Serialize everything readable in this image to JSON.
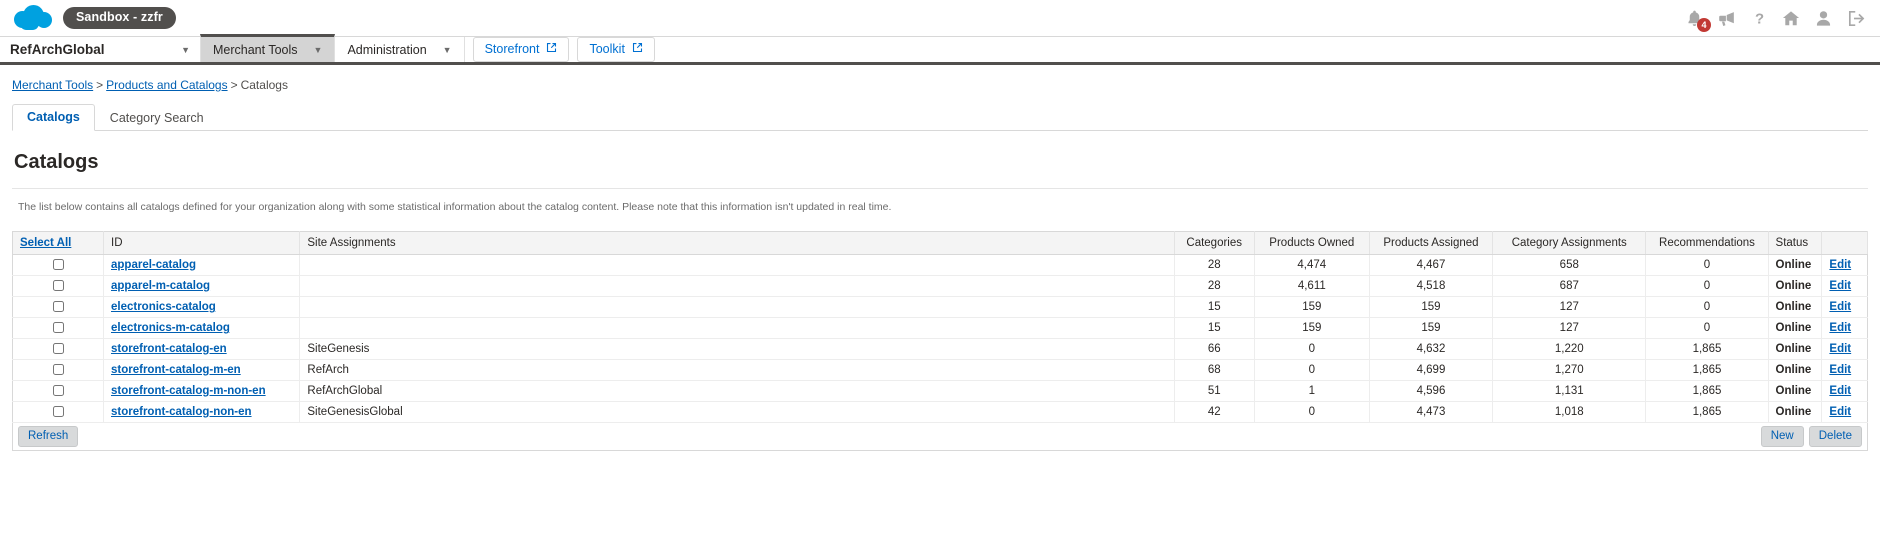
{
  "topbar": {
    "logo_name": "salesforce-cloud-logo",
    "sandbox_label": "Sandbox - zzfr",
    "icons": [
      {
        "name": "bell-icon",
        "badge": "4"
      },
      {
        "name": "megaphone-icon",
        "badge": ""
      },
      {
        "name": "help-question-icon",
        "badge": ""
      },
      {
        "name": "home-icon",
        "badge": ""
      },
      {
        "name": "user-profile-icon",
        "badge": ""
      },
      {
        "name": "logout-icon",
        "badge": ""
      }
    ]
  },
  "nav": {
    "org_label": "RefArchGlobal",
    "items": [
      {
        "label": "Merchant Tools",
        "active": true
      },
      {
        "label": "Administration",
        "active": false
      }
    ],
    "buttons": [
      {
        "label": "Storefront"
      },
      {
        "label": "Toolkit"
      }
    ]
  },
  "breadcrumb": {
    "items": [
      {
        "label": "Merchant Tools",
        "link": true
      },
      {
        "label": "Products and Catalogs",
        "link": true
      },
      {
        "label": "Catalogs",
        "link": false
      }
    ],
    "separator": ">"
  },
  "tabs": [
    {
      "label": "Catalogs",
      "active": true
    },
    {
      "label": "Category Search",
      "active": false
    }
  ],
  "page": {
    "title": "Catalogs",
    "description": "The list below contains all catalogs defined for your organization along with some statistical information about the catalog content. Please note that this information isn't updated in real time."
  },
  "table": {
    "select_all_label": "Select All",
    "headers": [
      "Select All",
      "ID",
      "Site Assignments",
      "Categories",
      "Products Owned",
      "Products Assigned",
      "Category Assignments",
      "Recommendations",
      "Status",
      ""
    ],
    "rows": [
      {
        "id": "apparel-catalog",
        "site": "",
        "categories": "28",
        "products_owned": "4,474",
        "products_assigned": "4,467",
        "category_assignments": "658",
        "recommendations": "0",
        "status": "Online",
        "edit": "Edit"
      },
      {
        "id": "apparel-m-catalog",
        "site": "",
        "categories": "28",
        "products_owned": "4,611",
        "products_assigned": "4,518",
        "category_assignments": "687",
        "recommendations": "0",
        "status": "Online",
        "edit": "Edit"
      },
      {
        "id": "electronics-catalog",
        "site": "",
        "categories": "15",
        "products_owned": "159",
        "products_assigned": "159",
        "category_assignments": "127",
        "recommendations": "0",
        "status": "Online",
        "edit": "Edit"
      },
      {
        "id": "electronics-m-catalog",
        "site": "",
        "categories": "15",
        "products_owned": "159",
        "products_assigned": "159",
        "category_assignments": "127",
        "recommendations": "0",
        "status": "Online",
        "edit": "Edit"
      },
      {
        "id": "storefront-catalog-en",
        "site": "SiteGenesis",
        "categories": "66",
        "products_owned": "0",
        "products_assigned": "4,632",
        "category_assignments": "1,220",
        "recommendations": "1,865",
        "status": "Online",
        "edit": "Edit"
      },
      {
        "id": "storefront-catalog-m-en",
        "site": "RefArch",
        "categories": "68",
        "products_owned": "0",
        "products_assigned": "4,699",
        "category_assignments": "1,270",
        "recommendations": "1,865",
        "status": "Online",
        "edit": "Edit"
      },
      {
        "id": "storefront-catalog-m-non-en",
        "site": "RefArchGlobal",
        "categories": "51",
        "products_owned": "1",
        "products_assigned": "4,596",
        "category_assignments": "1,131",
        "recommendations": "1,865",
        "status": "Online",
        "edit": "Edit"
      },
      {
        "id": "storefront-catalog-non-en",
        "site": "SiteGenesisGlobal",
        "categories": "42",
        "products_owned": "0",
        "products_assigned": "4,473",
        "category_assignments": "1,018",
        "recommendations": "1,865",
        "status": "Online",
        "edit": "Edit"
      }
    ]
  },
  "footer": {
    "refresh_label": "Refresh",
    "new_label": "New",
    "delete_label": "Delete"
  },
  "colors": {
    "brand_blue": "#00a1e0",
    "link_blue": "#005fb2",
    "badge_red": "#c23934",
    "sandbox_gray": "#514f4d"
  }
}
